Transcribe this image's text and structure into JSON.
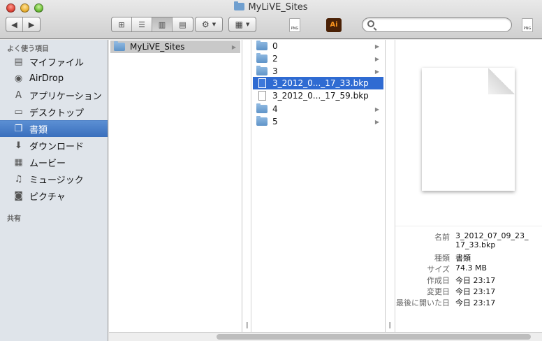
{
  "window": {
    "title": "MyLiVE_Sites"
  },
  "toolbar": {
    "view_icons": [
      "icon-view",
      "list-view",
      "column-view",
      "coverflow-view"
    ],
    "action_glyph": "⚙",
    "arrange_glyph": "▦",
    "search_placeholder": "",
    "png_label": "PNG",
    "ai_label": "Ai"
  },
  "sidebar": {
    "favorites_header": "よく使う項目",
    "shared_header": "共有",
    "items": [
      {
        "label": "マイファイル",
        "icon": "all-my-files-icon"
      },
      {
        "label": "AirDrop",
        "icon": "airdrop-icon"
      },
      {
        "label": "アプリケーション",
        "icon": "applications-icon"
      },
      {
        "label": "デスクトップ",
        "icon": "desktop-icon"
      },
      {
        "label": "書類",
        "icon": "documents-icon",
        "selected": true
      },
      {
        "label": "ダウンロード",
        "icon": "downloads-icon"
      },
      {
        "label": "ムービー",
        "icon": "movies-icon"
      },
      {
        "label": "ミュージック",
        "icon": "music-icon"
      },
      {
        "label": "ピクチャ",
        "icon": "pictures-icon"
      }
    ]
  },
  "columns": {
    "col1": [
      {
        "name": "MyLiVE_Sites",
        "type": "folder",
        "state": "highlighted"
      }
    ],
    "col2": [
      {
        "name": "0",
        "type": "folder"
      },
      {
        "name": "2",
        "type": "folder"
      },
      {
        "name": "3",
        "type": "folder"
      },
      {
        "name": "3_2012_0..._17_33.bkp",
        "type": "file",
        "state": "selected"
      },
      {
        "name": "3_2012_0..._17_59.bkp",
        "type": "file"
      },
      {
        "name": "4",
        "type": "folder"
      },
      {
        "name": "5",
        "type": "folder"
      }
    ]
  },
  "preview": {
    "info": [
      {
        "key": "名前",
        "value": "3_2012_07_09_23_17_33.bkp"
      },
      {
        "key": "種類",
        "value": "書類"
      },
      {
        "key": "サイズ",
        "value": "74.3 MB"
      },
      {
        "key": "作成日",
        "value": "今日 23:17"
      },
      {
        "key": "変更日",
        "value": "今日 23:17"
      },
      {
        "key": "最後に開いた日",
        "value": "今日 23:17"
      }
    ]
  }
}
